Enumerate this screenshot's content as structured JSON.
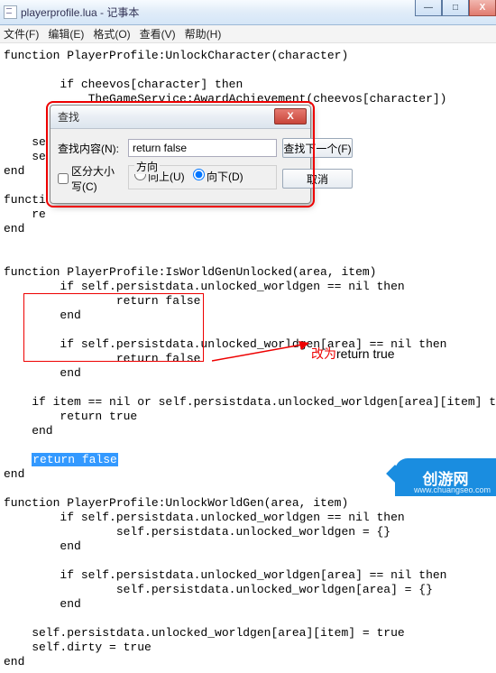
{
  "titlebar": {
    "filename": "playerprofile.lua - 记事本"
  },
  "winctl": {
    "min": "—",
    "max": "□",
    "close": "X"
  },
  "menu": {
    "file": "文件(F)",
    "edit": "编辑(E)",
    "format": "格式(O)",
    "view": "查看(V)",
    "help": "帮助(H)"
  },
  "code": "function PlayerProfile:UnlockCharacter(character)\n\n        if cheevos[character] then\n            TheGameService:AwardAchievement(cheevos[character])\n        end\n\n    se\n    se\nend\n\nfuncti\n    re\nend\n\n\nfunction PlayerProfile:IsWorldGenUnlocked(area, item)\n        if self.persistdata.unlocked_worldgen == nil then\n                return false\n        end\n\n        if self.persistdata.unlocked_worldgen[area] == nil then\n                return false\n        end\n\n    if item == nil or self.persistdata.unlocked_worldgen[area][item] then\n        return true\n    end\n\n    ",
  "highlight": "return false",
  "codetail": "\nend\n\nfunction PlayerProfile:UnlockWorldGen(area, item)\n        if self.persistdata.unlocked_worldgen == nil then\n                self.persistdata.unlocked_worldgen = {}\n        end\n\n        if self.persistdata.unlocked_worldgen[area] == nil then\n                self.persistdata.unlocked_worldgen[area] = {}\n        end\n\n    self.persistdata.unlocked_worldgen[area][item] = true\n    self.dirty = true\nend",
  "annotation": {
    "zh": "改为",
    "en": "return true"
  },
  "dialog": {
    "title": "查找",
    "label_what": "查找内容(N):",
    "input_value": "return false",
    "btn_next": "查找下一个(F)",
    "btn_cancel": "取消",
    "chk_case": "区分大小写(C)",
    "dir_legend": "方向",
    "dir_up": "向上(U)",
    "dir_down": "向下(D)"
  },
  "watermark": {
    "brand": "创游网",
    "url": "www.chuangseo.com"
  }
}
